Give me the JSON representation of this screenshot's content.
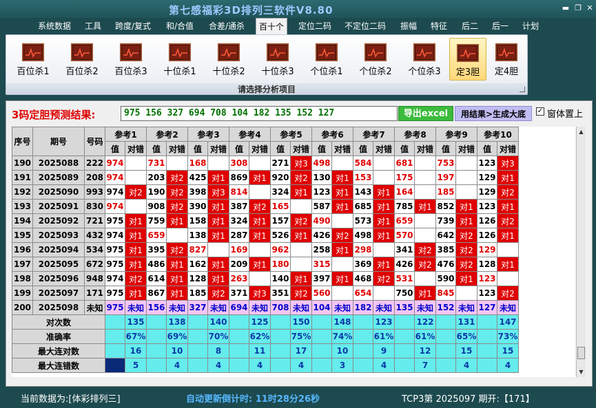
{
  "app": {
    "title": "第七感福彩3D排列三软件V8.80"
  },
  "menu": [
    "系统数据",
    "工具",
    "跨度/复式",
    "和/合值",
    "合差/通杀",
    "百十个",
    "定位二码",
    "不定位二码",
    "振幅",
    "特征",
    "后二",
    "后一",
    "计划"
  ],
  "ribbon": {
    "buttons": [
      "百位杀1",
      "百位杀2",
      "百位杀3",
      "十位杀1",
      "十位杀2",
      "十位杀3",
      "个位杀1",
      "个位杀2",
      "个位杀3",
      "定3胆",
      "定4胆"
    ],
    "active_index": 9,
    "group_label": "请选择分析项目"
  },
  "prediction": {
    "label": "3码定胆预测结果:",
    "value": "975 156 327 694 708 104 182 135 152 127",
    "export_button": "导出excel",
    "generate_button": "用结果>生成大底",
    "ontop_checked": "✓",
    "ontop_label": "窗体置上"
  },
  "table": {
    "headers": {
      "seq": "序号",
      "period": "期号",
      "number": "号码",
      "value": "值",
      "check": "对错",
      "refs": [
        "参考1",
        "参考2",
        "参考3",
        "参考4",
        "参考5",
        "参考6",
        "参考7",
        "参考8",
        "参考9",
        "参考10"
      ]
    },
    "rows": [
      {
        "seq": "190",
        "period": "2025088",
        "num": "222",
        "cells": [
          [
            "974",
            ""
          ],
          [
            "731",
            ""
          ],
          [
            "168",
            ""
          ],
          [
            "308",
            ""
          ],
          [
            "271",
            "对3"
          ],
          [
            "498",
            ""
          ],
          [
            "584",
            ""
          ],
          [
            "681",
            ""
          ],
          [
            "753",
            ""
          ],
          [
            "123",
            "对3"
          ]
        ]
      },
      {
        "seq": "191",
        "period": "2025089",
        "num": "208",
        "cells": [
          [
            "974",
            ""
          ],
          [
            "203",
            "对2"
          ],
          [
            "425",
            "对1"
          ],
          [
            "869",
            "对1"
          ],
          [
            "920",
            "对2"
          ],
          [
            "130",
            "对1"
          ],
          [
            "153",
            ""
          ],
          [
            "175",
            ""
          ],
          [
            "197",
            ""
          ],
          [
            "129",
            "对1"
          ]
        ]
      },
      {
        "seq": "192",
        "period": "2025090",
        "num": "993",
        "cells": [
          [
            "974",
            "对2"
          ],
          [
            "190",
            "对2"
          ],
          [
            "398",
            "对3"
          ],
          [
            "814",
            ""
          ],
          [
            "324",
            "对1"
          ],
          [
            "123",
            "对1"
          ],
          [
            "143",
            "对1"
          ],
          [
            "164",
            ""
          ],
          [
            "185",
            ""
          ],
          [
            "129",
            "对2"
          ]
        ]
      },
      {
        "seq": "193",
        "period": "2025091",
        "num": "830",
        "cells": [
          [
            "974",
            ""
          ],
          [
            "908",
            "对2"
          ],
          [
            "390",
            "对1"
          ],
          [
            "387",
            "对2"
          ],
          [
            "165",
            ""
          ],
          [
            "587",
            "对1"
          ],
          [
            "685",
            "对1"
          ],
          [
            "785",
            "对1"
          ],
          [
            "852",
            "对1"
          ],
          [
            "123",
            "对1"
          ]
        ]
      },
      {
        "seq": "194",
        "period": "2025092",
        "num": "721",
        "cells": [
          [
            "975",
            "对1"
          ],
          [
            "759",
            "对1"
          ],
          [
            "158",
            "对1"
          ],
          [
            "324",
            "对1"
          ],
          [
            "157",
            "对2"
          ],
          [
            "490",
            ""
          ],
          [
            "573",
            "对1"
          ],
          [
            "659",
            ""
          ],
          [
            "739",
            "对1"
          ],
          [
            "126",
            "对2"
          ]
        ]
      },
      {
        "seq": "195",
        "period": "2025093",
        "num": "432",
        "cells": [
          [
            "974",
            "对1"
          ],
          [
            "659",
            ""
          ],
          [
            "138",
            "对1"
          ],
          [
            "287",
            "对1"
          ],
          [
            "526",
            "对1"
          ],
          [
            "426",
            "对2"
          ],
          [
            "498",
            "对1"
          ],
          [
            "570",
            ""
          ],
          [
            "642",
            "对2"
          ],
          [
            "126",
            "对1"
          ]
        ]
      },
      {
        "seq": "196",
        "period": "2025094",
        "num": "534",
        "cells": [
          [
            "975",
            "对1"
          ],
          [
            "395",
            "对2"
          ],
          [
            "827",
            ""
          ],
          [
            "169",
            ""
          ],
          [
            "962",
            ""
          ],
          [
            "258",
            "对1"
          ],
          [
            "298",
            ""
          ],
          [
            "341",
            "对2"
          ],
          [
            "385",
            "对2"
          ],
          [
            "129",
            ""
          ]
        ]
      },
      {
        "seq": "197",
        "period": "2025095",
        "num": "672",
        "cells": [
          [
            "975",
            "对1"
          ],
          [
            "486",
            "对1"
          ],
          [
            "162",
            "对1"
          ],
          [
            "209",
            "对1"
          ],
          [
            "180",
            ""
          ],
          [
            "315",
            ""
          ],
          [
            "369",
            "对1"
          ],
          [
            "426",
            "对2"
          ],
          [
            "476",
            "对2"
          ],
          [
            "128",
            "对1"
          ]
        ]
      },
      {
        "seq": "198",
        "period": "2025096",
        "num": "948",
        "cells": [
          [
            "974",
            "对2"
          ],
          [
            "614",
            "对1"
          ],
          [
            "128",
            "对1"
          ],
          [
            "263",
            ""
          ],
          [
            "140",
            "对1"
          ],
          [
            "397",
            "对1"
          ],
          [
            "468",
            "对2"
          ],
          [
            "531",
            ""
          ],
          [
            "590",
            "对1"
          ],
          [
            "123",
            ""
          ]
        ]
      },
      {
        "seq": "199",
        "period": "2025097",
        "num": "171",
        "cells": [
          [
            "975",
            "对1"
          ],
          [
            "867",
            "对1"
          ],
          [
            "185",
            "对2"
          ],
          [
            "371",
            "对3"
          ],
          [
            "351",
            "对2"
          ],
          [
            "560",
            ""
          ],
          [
            "654",
            ""
          ],
          [
            "750",
            "对1"
          ],
          [
            "845",
            ""
          ],
          [
            "123",
            "对2"
          ]
        ]
      }
    ],
    "unknown_row": {
      "seq": "200",
      "period": "2025098",
      "num": "未知",
      "cells": [
        [
          "975",
          "未知"
        ],
        [
          "156",
          "未知"
        ],
        [
          "327",
          "未知"
        ],
        [
          "694",
          "未知"
        ],
        [
          "708",
          "未知"
        ],
        [
          "104",
          "未知"
        ],
        [
          "182",
          "未知"
        ],
        [
          "135",
          "未知"
        ],
        [
          "152",
          "未知"
        ],
        [
          "127",
          "未知"
        ]
      ]
    },
    "stats": [
      {
        "label": "对次数",
        "values": [
          "135",
          "138",
          "140",
          "125",
          "150",
          "148",
          "123",
          "122",
          "131",
          "147"
        ]
      },
      {
        "label": "准确率",
        "values": [
          "67%",
          "69%",
          "70%",
          "62%",
          "75%",
          "74%",
          "61%",
          "61%",
          "65%",
          "73%"
        ]
      },
      {
        "label": "最大连对数",
        "values": [
          "16",
          "10",
          "8",
          "11",
          "17",
          "10",
          "9",
          "12",
          "15",
          "15"
        ]
      },
      {
        "label": "最大连错数",
        "values": [
          "5",
          "4",
          "4",
          "4",
          "4",
          "3",
          "4",
          "7",
          "4",
          "4"
        ]
      }
    ]
  },
  "status": {
    "data_source": "当前数据为:[体彩排列三]",
    "countdown": "自动更新倒计时: 11时28分26秒",
    "latest": "TCP3第 2025097 期开:【171】"
  },
  "colors": {
    "hit_red": "#e00000",
    "stat_cyan": "#65ecec",
    "unknown_pink": "#f3c6f3",
    "title_blue": "#9ec9ff"
  }
}
